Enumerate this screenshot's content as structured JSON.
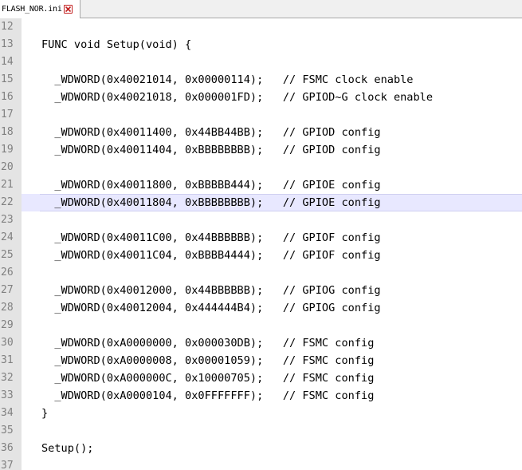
{
  "tab": {
    "title": "FLASH_NOR.ini",
    "close_icon": "close-icon",
    "close_color": "#c21f1f"
  },
  "editor": {
    "current_line_color": "#e8e8ff",
    "gutter_color": "#e4e4e4",
    "lines": [
      {
        "n": "12",
        "text": ""
      },
      {
        "n": "13",
        "text": "FUNC void Setup(void) {"
      },
      {
        "n": "14",
        "text": ""
      },
      {
        "n": "15",
        "text": "  _WDWORD(0x40021014, 0x00000114);   // FSMC clock enable"
      },
      {
        "n": "16",
        "text": "  _WDWORD(0x40021018, 0x000001FD);   // GPIOD~G clock enable"
      },
      {
        "n": "17",
        "text": ""
      },
      {
        "n": "18",
        "text": "  _WDWORD(0x40011400, 0x44BB44BB);   // GPIOD config"
      },
      {
        "n": "19",
        "text": "  _WDWORD(0x40011404, 0xBBBBBBBB);   // GPIOD config"
      },
      {
        "n": "20",
        "text": ""
      },
      {
        "n": "21",
        "text": "  _WDWORD(0x40011800, 0xBBBBB444);   // GPIOE config"
      },
      {
        "n": "22",
        "text": "  _WDWORD(0x40011804, 0xBBBBBBBB);   // GPIOE config",
        "current": true
      },
      {
        "n": "23",
        "text": ""
      },
      {
        "n": "24",
        "text": "  _WDWORD(0x40011C00, 0x44BBBBBB);   // GPIOF config"
      },
      {
        "n": "25",
        "text": "  _WDWORD(0x40011C04, 0xBBBB4444);   // GPIOF config"
      },
      {
        "n": "26",
        "text": ""
      },
      {
        "n": "27",
        "text": "  _WDWORD(0x40012000, 0x44BBBBBB);   // GPIOG config"
      },
      {
        "n": "28",
        "text": "  _WDWORD(0x40012004, 0x444444B4);   // GPIOG config"
      },
      {
        "n": "29",
        "text": ""
      },
      {
        "n": "30",
        "text": "  _WDWORD(0xA0000000, 0x000030DB);   // FSMC config"
      },
      {
        "n": "31",
        "text": "  _WDWORD(0xA0000008, 0x00001059);   // FSMC config"
      },
      {
        "n": "32",
        "text": "  _WDWORD(0xA000000C, 0x10000705);   // FSMC config"
      },
      {
        "n": "33",
        "text": "  _WDWORD(0xA0000104, 0x0FFFFFFF);   // FSMC config"
      },
      {
        "n": "34",
        "text": "}"
      },
      {
        "n": "35",
        "text": ""
      },
      {
        "n": "36",
        "text": "Setup();"
      },
      {
        "n": "37",
        "text": ""
      }
    ]
  }
}
